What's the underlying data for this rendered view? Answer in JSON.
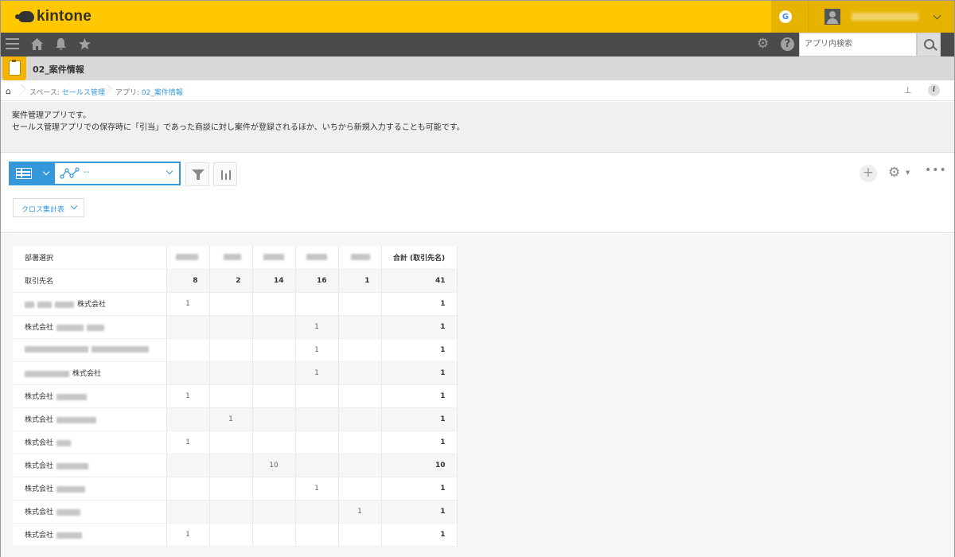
{
  "header": {
    "logo_text": "kintone",
    "g_badge": "G",
    "brand_color": "#ffc800"
  },
  "toolbar": {
    "search_placeholder": "アプリ内検索"
  },
  "app": {
    "title": "02_案件情報"
  },
  "breadcrumb": {
    "space_prefix": "スペース: ",
    "space_name": "セールス管理",
    "app_prefix": "アプリ: ",
    "app_name": "02_案件情報"
  },
  "description": {
    "line1": "案件管理アプリです。",
    "line2": "セールス管理アプリでの保存時に「引当」であった商談に対し案件が登録されるほか、いちから新規入力することも可能です。"
  },
  "view": {
    "graph_label": "--",
    "cross_label": "クロス集計表",
    "accent_color": "#3498db"
  },
  "cross_table": {
    "row_field_header": "部署選択",
    "total_header": "合計 (取引先名)",
    "count_row_label": "取引先名",
    "column_totals": [
      "8",
      "2",
      "14",
      "16",
      "1"
    ],
    "grand_total": "41",
    "rows": [
      {
        "name_suffix": "株式会社",
        "cells": [
          "1",
          "",
          "",
          "",
          ""
        ],
        "total": "1"
      },
      {
        "name_suffix": "株式会社",
        "cells": [
          "",
          "",
          "",
          "1",
          ""
        ],
        "total": "1"
      },
      {
        "name_suffix": "",
        "cells": [
          "",
          "",
          "",
          "1",
          ""
        ],
        "total": "1"
      },
      {
        "name_suffix": "株式会社",
        "cells": [
          "",
          "",
          "",
          "1",
          ""
        ],
        "total": "1"
      },
      {
        "name_suffix": "株式会社",
        "cells": [
          "1",
          "",
          "",
          "",
          ""
        ],
        "total": "1"
      },
      {
        "name_suffix": "株式会社",
        "cells": [
          "",
          "1",
          "",
          "",
          ""
        ],
        "total": "1"
      },
      {
        "name_suffix": "株式会社",
        "cells": [
          "1",
          "",
          "",
          "",
          ""
        ],
        "total": "1"
      },
      {
        "name_suffix": "株式会社",
        "cells": [
          "",
          "",
          "10",
          "",
          ""
        ],
        "total": "10"
      },
      {
        "name_suffix": "株式会社",
        "cells": [
          "",
          "",
          "",
          "1",
          ""
        ],
        "total": "1"
      },
      {
        "name_suffix": "株式会社",
        "cells": [
          "",
          "",
          "",
          "",
          "1"
        ],
        "total": "1"
      },
      {
        "name_suffix": "株式会社",
        "cells": [
          "1",
          "",
          "",
          "",
          ""
        ],
        "total": "1"
      }
    ]
  }
}
